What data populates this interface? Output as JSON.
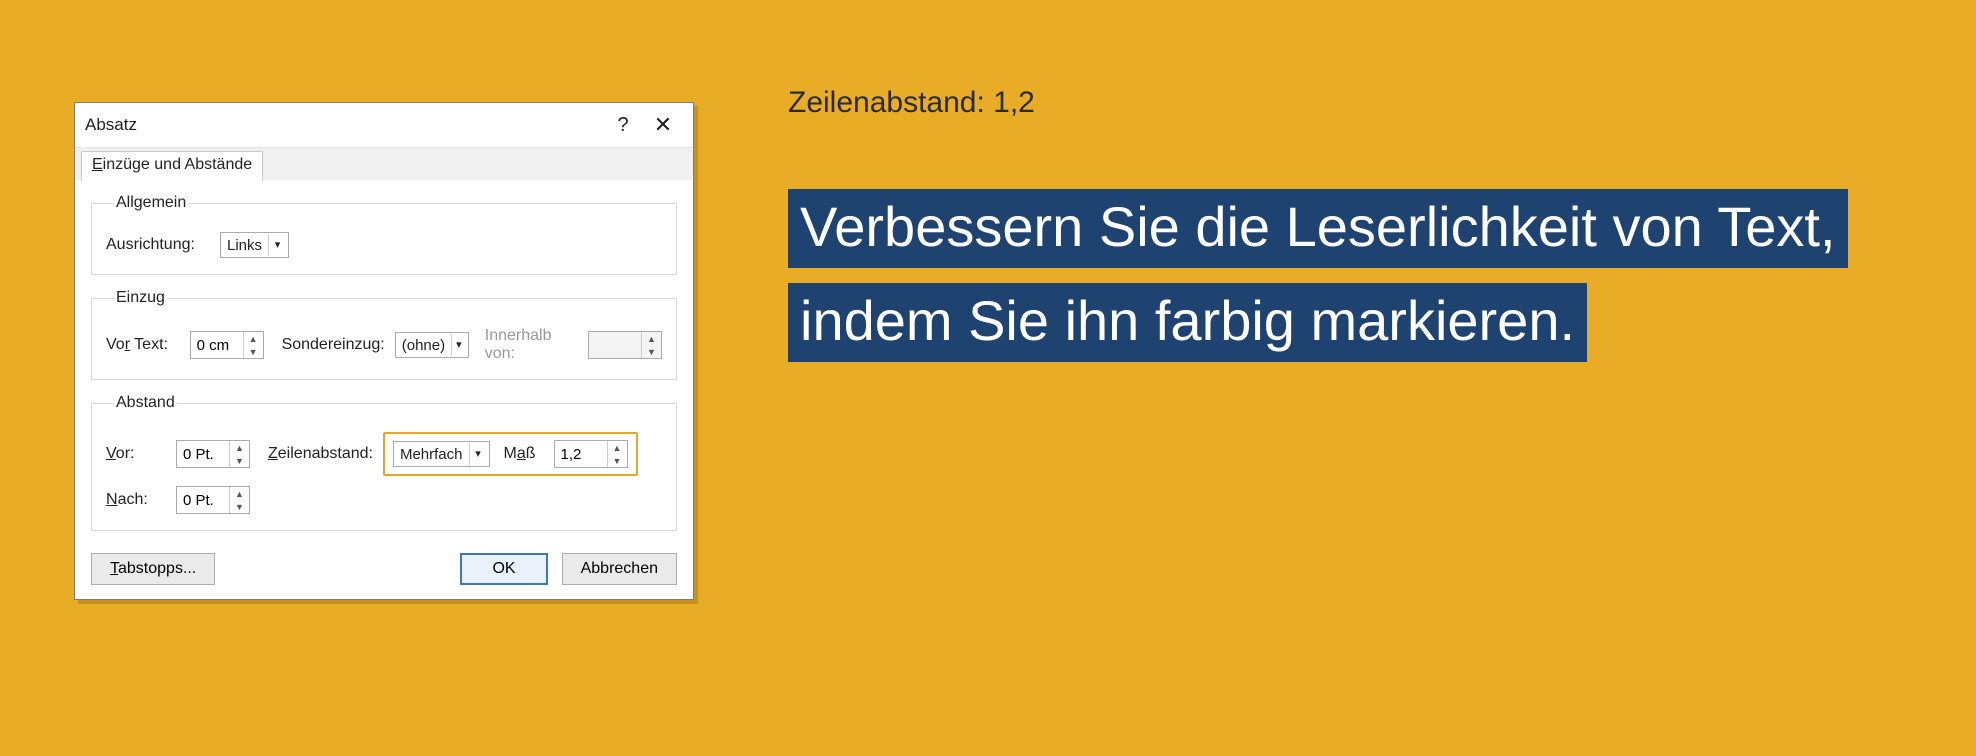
{
  "annotation": {
    "caption": "Zeilenabstand: 1,2",
    "body": "Verbessern Sie die Leserlichkeit von Text, indem Sie ihn farbig markieren."
  },
  "dialog": {
    "title": "Absatz",
    "help": "?",
    "close": "✕",
    "tab": "Einzüge und Abstände",
    "allgemein": {
      "legend": "Allgemein",
      "ausrichtung_label": "Ausrichtung:",
      "ausrichtung_value": "Links"
    },
    "einzug": {
      "legend": "Einzug",
      "vor_text_label": "Vor Text:",
      "vor_text_value": "0 cm",
      "sondereinzug_label": "Sondereinzug:",
      "sondereinzug_value": "(ohne)",
      "innerhalb_label": "Innerhalb von:",
      "innerhalb_value": ""
    },
    "abstand": {
      "legend": "Abstand",
      "vor_label": "Vor:",
      "vor_value": "0 Pt.",
      "nach_label": "Nach:",
      "nach_value": "0 Pt.",
      "zeilenabstand_label": "Zeilenabstand:",
      "zeilenabstand_value": "Mehrfach",
      "mass_label": "Maß",
      "mass_value": "1,2"
    },
    "footer": {
      "tabstopps": "Tabstopps...",
      "ok": "OK",
      "cancel": "Abbrechen"
    }
  }
}
